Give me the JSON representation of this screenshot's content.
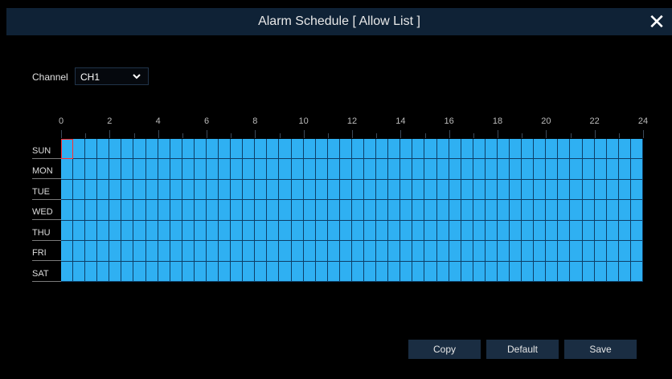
{
  "dialog": {
    "title": "Alarm Schedule [ Allow List ]",
    "close_glyph": "✕"
  },
  "channel": {
    "label": "Channel",
    "value": "CH1"
  },
  "timeline": {
    "hour_labels": [
      "0",
      "2",
      "4",
      "6",
      "8",
      "10",
      "12",
      "14",
      "16",
      "18",
      "20",
      "22",
      "24"
    ]
  },
  "days": [
    "SUN",
    "MON",
    "TUE",
    "WED",
    "THU",
    "FRI",
    "SAT"
  ],
  "schedule": {
    "slots_per_day": 48,
    "all_slots_enabled": true,
    "selected_cell": {
      "day": "SUN",
      "slot": 0
    },
    "enabled_color": "#2fb0f2",
    "selection_color": "#ff2d2d"
  },
  "buttons": {
    "copy": "Copy",
    "default": "Default",
    "save": "Save"
  },
  "icons": {
    "close": "close-icon",
    "channel_dropdown": "chevron-down-icon"
  },
  "colors": {
    "background": "#000000",
    "titlebar": "#0f2236",
    "button": "#1a2d42"
  }
}
